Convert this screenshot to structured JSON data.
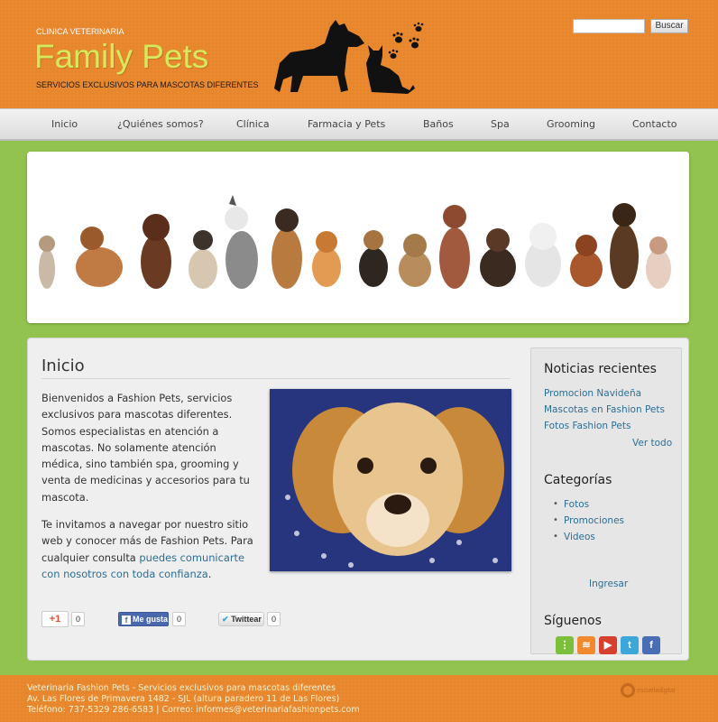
{
  "header": {
    "clinic_label": "CLINICA VETERINARIA",
    "brand": "Family Pets",
    "tagline": "SERVICIOS EXCLUSIVOS PARA MASCOTAS DIFERENTES",
    "search_placeholder": "",
    "search_button": "Buscar"
  },
  "nav": {
    "items": [
      {
        "label": "Inicio"
      },
      {
        "label": "¿Quiénes somos?"
      },
      {
        "label": "Clínica"
      },
      {
        "label": "Farmacia y Pets"
      },
      {
        "label": "Baños"
      },
      {
        "label": "Spa"
      },
      {
        "label": "Grooming"
      },
      {
        "label": "Contacto"
      }
    ]
  },
  "main": {
    "title": "Inicio",
    "paragraph1": "Bienvenidos a Fashion Pets, servicios exclusivos para mascotas diferentes. Somos especialistas en atención a mascotas. No solamente atención médica, sino también spa, grooming y venta de medicinas y accesorios para tu mascota.",
    "paragraph2_before": "Te invitamos a navegar por nuestro sitio web y conocer más de Fashion Pets. Para cualquier consulta ",
    "paragraph2_link": "puedes comunicarte con nosotros con toda confianza",
    "paragraph2_after": "."
  },
  "share": {
    "gplus_label": "+1",
    "gplus_count": "0",
    "facebook_label": "Me gusta",
    "facebook_count": "0",
    "twitter_label": "Twittear",
    "twitter_count": "0"
  },
  "sidebar": {
    "news_heading": "Noticias recientes",
    "news": [
      {
        "label": "Promocion Navideña"
      },
      {
        "label": "Mascotas en Fashion Pets"
      },
      {
        "label": "Fotos Fashion Pets"
      }
    ],
    "view_all": "Ver todo",
    "categories_heading": "Categorías",
    "categories": [
      {
        "label": "Fotos"
      },
      {
        "label": "Promociones"
      },
      {
        "label": "Videos"
      }
    ],
    "login": "Ingresar",
    "follow_heading": "Síguenos",
    "social_icons": [
      "sitemap-icon",
      "rss-icon",
      "youtube-icon",
      "twitter-icon",
      "facebook-icon"
    ]
  },
  "footer": {
    "line1": "Veterinaria Fashion Pets - Servicios exclusivos para mascotas diferentes",
    "line2": "Av. Las Flores de Primavera 1482 - SJL (altura paradero 11 de Las Flores)",
    "line3": "Teléfono: 737-5329 286-6583 | Correo: informes@veterinariafashionpets.com",
    "logo_text": "escueladigital"
  },
  "colors": {
    "header_orange": "#e8862c",
    "brand_green": "#d4ea5c",
    "page_green": "#93c34f",
    "link_blue": "#2d6e93"
  }
}
